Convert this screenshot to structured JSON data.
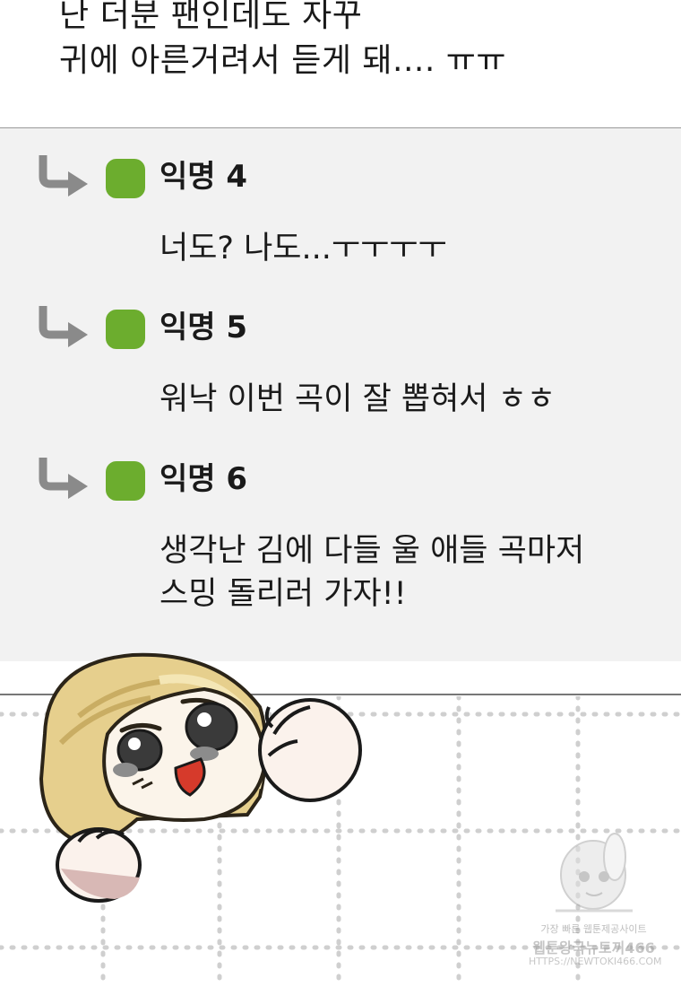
{
  "top_post": {
    "line1": "난 더분 팬인데도 자꾸",
    "line2": "귀에 아른거려서 듣게 돼.... ㅠㅠ"
  },
  "replies": [
    {
      "name": "익명 4",
      "lines": [
        "너도? 나도...ㅜㅜㅜㅜ"
      ]
    },
    {
      "name": "익명 5",
      "lines": [
        "워낙 이번 곡이 잘 뽑혀서 ㅎㅎ"
      ]
    },
    {
      "name": "익명 6",
      "lines": [
        "생각난 김에 다들 울 애들 곡마저",
        "스밍 돌리러 가자!!"
      ]
    }
  ],
  "watermark": {
    "line1": "가장 빠른 웹툰제공사이트",
    "line2": "웹툰왕국뉴토끼466",
    "line3": "HTTPS://NEWTOKI466.COM"
  },
  "colors": {
    "reply_bg": "#f2f2f2",
    "badge_green": "#6cad2e",
    "arrow_gray": "#8a8a8a"
  },
  "icons": [
    "reply-arrow-icon",
    "green-badge-icon"
  ]
}
